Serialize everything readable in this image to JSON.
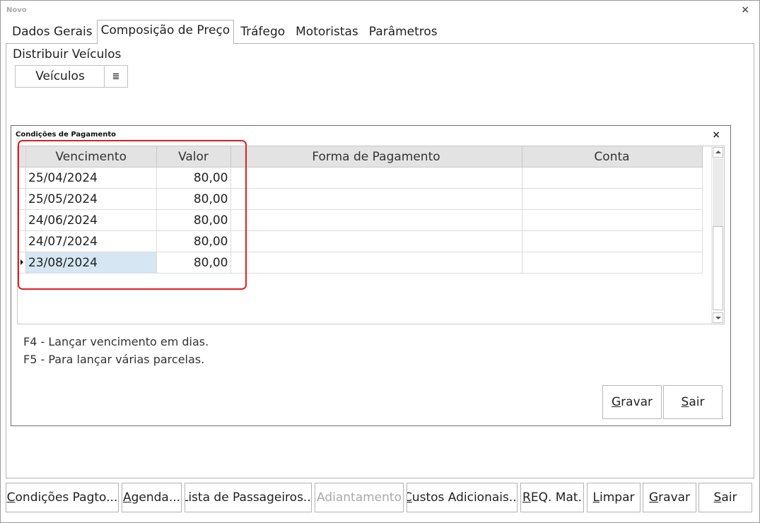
{
  "window": {
    "title": "Novo",
    "close_glyph": "×"
  },
  "tabs": [
    {
      "label": "Dados Gerais"
    },
    {
      "label": "Composição de Preço"
    },
    {
      "label": "Tráfego"
    },
    {
      "label": "Motoristas"
    },
    {
      "label": "Parâmetros"
    }
  ],
  "active_tab": "Composição de Preço",
  "distribuir": {
    "label": "Distribuir Veículos",
    "button_label": "Veículos",
    "menu_icon": "list-icon",
    "menu_glyph": "≣"
  },
  "dialog": {
    "title": "Condições de Pagamento",
    "close_glyph": "×",
    "columns": [
      "Vencimento",
      "Valor",
      "Forma de Pagamento",
      "Conta"
    ],
    "rows": [
      {
        "vencimento": "25/04/2024",
        "valor": "80,00",
        "forma": "",
        "conta": ""
      },
      {
        "vencimento": "25/05/2024",
        "valor": "80,00",
        "forma": "",
        "conta": ""
      },
      {
        "vencimento": "24/06/2024",
        "valor": "80,00",
        "forma": "",
        "conta": ""
      },
      {
        "vencimento": "24/07/2024",
        "valor": "80,00",
        "forma": "",
        "conta": ""
      },
      {
        "vencimento": "23/08/2024",
        "valor": "80,00",
        "forma": "",
        "conta": ""
      }
    ],
    "hints": [
      "F4 - Lançar vencimento em dias.",
      "F5 - Para lançar várias parcelas."
    ],
    "buttons": {
      "gravar_first": "G",
      "gravar_rest": "ravar",
      "sair_first": "S",
      "sair_rest": "air"
    }
  },
  "bottom_buttons": {
    "condicoes": {
      "first": "C",
      "rest": "ondições Pagto..."
    },
    "agenda": {
      "first": "A",
      "rest": "genda..."
    },
    "lista": {
      "label": "Lista de Passageiros..."
    },
    "adiantamento": {
      "label": "Adiantamento"
    },
    "custos": {
      "first": "C",
      "rest": "ustos Adicionais..."
    },
    "req": {
      "first": "R",
      "rest": "EQ. Mat."
    },
    "limpar": {
      "first": "L",
      "rest": "impar"
    },
    "gravar": {
      "first": "G",
      "rest": "ravar"
    },
    "sair": {
      "first": "S",
      "rest": "air"
    }
  },
  "colors": {
    "highlight_box": "#e21e1e",
    "selected_cell": "#d6e6f2",
    "header_bg": "#e3e3e3"
  }
}
